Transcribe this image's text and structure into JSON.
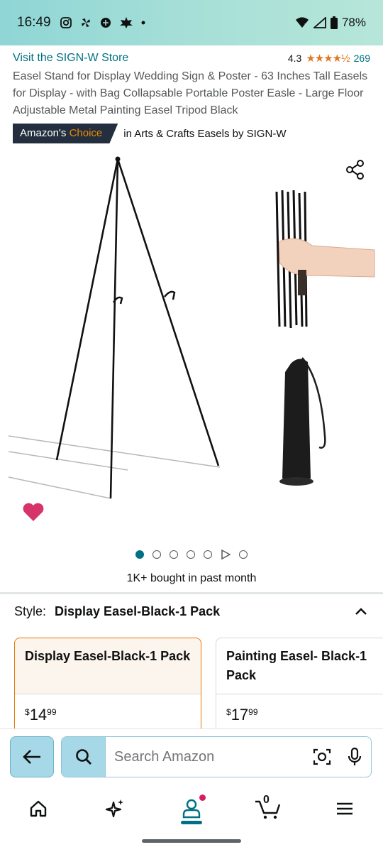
{
  "status_bar": {
    "time": "16:49",
    "icons": [
      "instagram-icon",
      "pinwheel-icon",
      "app-icon",
      "leaf-icon",
      "dot-icon"
    ],
    "battery": "78%"
  },
  "product": {
    "store_link": "Visit the SIGN-W Store",
    "rating": "4.3",
    "stars": "★★★★½",
    "rating_count": "269",
    "title": "Easel Stand for Display Wedding Sign & Poster - 63 Inches Tall Easels for Display - with Bag Collapsable Portable Poster Easle - Large Floor Adjustable Metal Painting Easel Tripod Black",
    "choice_badge_prefix": "Amazon's",
    "choice_badge_accent": "Choice",
    "choice_category": "in Arts & Crafts Easels by SIGN-W",
    "bought": "1K+ bought in past month",
    "image_count": 7,
    "active_image": 0
  },
  "style_selector": {
    "label": "Style:",
    "value": "Display Easel-Black-1 Pack",
    "options": [
      {
        "title": "Display Easel-Black-1 Pack",
        "price_symbol": "$",
        "price_whole": "14",
        "price_fraction": "99",
        "selected": true
      },
      {
        "title": "Painting Easel- Black-1 Pack",
        "price_symbol": "$",
        "price_whole": "17",
        "price_fraction": "99",
        "selected": false
      }
    ]
  },
  "search": {
    "placeholder": "Search Amazon"
  },
  "bottom_nav": {
    "cart_count": "0"
  },
  "colors": {
    "link": "#007185",
    "star": "#de7921",
    "badge_bg": "#232f3e",
    "badge_accent": "#f08804",
    "heart": "#d6336c",
    "selected_border": "#e77600"
  }
}
